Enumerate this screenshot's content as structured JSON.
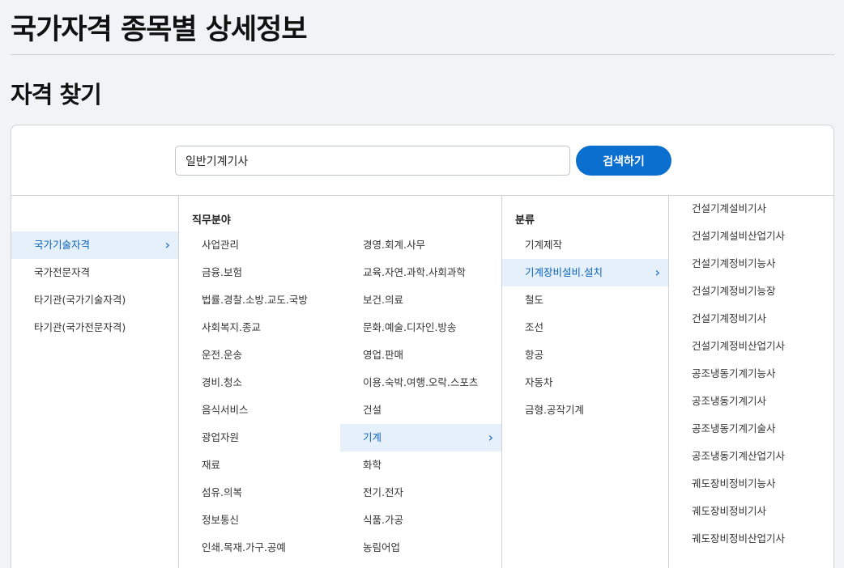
{
  "header": {
    "page_title": "국가자격 종목별 상세정보",
    "section_title": "자격 찾기"
  },
  "search": {
    "value": "일반기계기사",
    "button_label": "검색하기"
  },
  "qualification_types": [
    {
      "label": "국가기술자격",
      "selected": true
    },
    {
      "label": "국가전문자격",
      "selected": false
    },
    {
      "label": "타기관(국가기술자격)",
      "selected": false
    },
    {
      "label": "타기관(국가전문자격)",
      "selected": false
    }
  ],
  "job_fields": {
    "heading": "직무분야",
    "left_column": [
      "사업관리",
      "금융.보험",
      "법률.경찰.소방.교도.국방",
      "사회복지.종교",
      "운전.운송",
      "경비.청소",
      "음식서비스",
      "광업자원",
      "재료",
      "섬유.의복",
      "정보통신",
      "인쇄.목재.가구.공예"
    ],
    "right_column": [
      "경영.회계.사무",
      "교육.자연.과학.사회과학",
      "보건.의료",
      "문화.예술.디자인.방송",
      "영업.판매",
      "이용.숙박.여행.오락.스포츠",
      "건설",
      "기계",
      "화학",
      "전기.전자",
      "식품.가공",
      "농림어업"
    ],
    "selected": "기계"
  },
  "classification": {
    "heading": "분류",
    "items": [
      "기계제작",
      "기계장비설비.설치",
      "철도",
      "조선",
      "항공",
      "자동차",
      "금형.공작기계"
    ],
    "selected": "기계장비설비.설치"
  },
  "certifications": [
    "건설기계설비기사",
    "건설기계설비산업기사",
    "건설기계정비기능사",
    "건설기계정비기능장",
    "건설기계정비기사",
    "건설기계정비산업기사",
    "공조냉동기계기능사",
    "공조냉동기계기사",
    "공조냉동기계기술사",
    "공조냉동기계산업기사",
    "궤도장비정비기능사",
    "궤도장비정비기사",
    "궤도장비정비산업기사"
  ],
  "icons": {
    "chevron": "chevron-right-icon"
  },
  "colors": {
    "accent": "#0b6fd0",
    "selected_bg": "#e5f0fa",
    "selected_text": "#0b63b8"
  }
}
